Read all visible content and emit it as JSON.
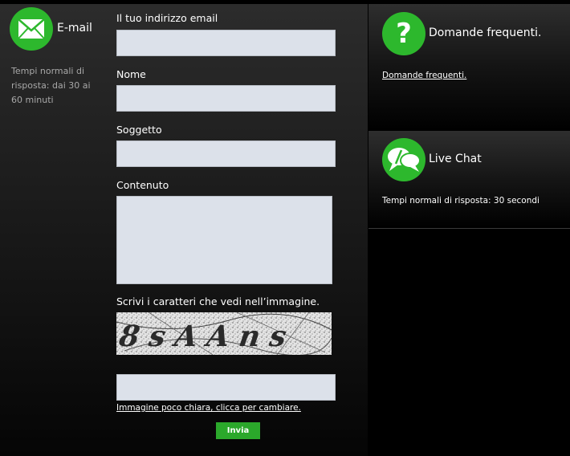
{
  "email_panel": {
    "title": "E-mail",
    "response_note": "Tempi normali di risposta: dai 30 ai 60 minuti"
  },
  "form": {
    "email_label": "Il tuo indirizzo email",
    "name_label": "Nome",
    "subject_label": "Soggetto",
    "content_label": "Contenuto",
    "captcha_label": "Scrivi i caratteri che vedi nell’immagine.",
    "captcha_text": "8sAAns",
    "refresh_link": "Immagine poco chiara, clicca per cambiare.",
    "submit_label": "Invia"
  },
  "faq_panel": {
    "title": "Domande frequenti.",
    "link": "Domande frequenti."
  },
  "chat_panel": {
    "title": "Live Chat",
    "response_note": "Tempi normali di risposta: 30 secondi"
  },
  "colors": {
    "accent_green": "#2db82d",
    "field_bg": "#dce1ea"
  },
  "icons": {
    "email": "envelope-icon",
    "faq": "question-mark-icon",
    "chat": "speech-bubbles-icon"
  }
}
